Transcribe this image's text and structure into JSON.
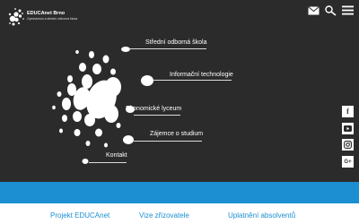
{
  "logo": {
    "title": "EDUCAnet Brno",
    "subtitle": "Gymnázium a střední odborná škola"
  },
  "header": {
    "icons": [
      "mail-icon",
      "search-icon",
      "menu-icon"
    ]
  },
  "menu": [
    {
      "label": "Střední odborná škola"
    },
    {
      "label": "Informační technologie"
    },
    {
      "label": "Ekonomické lyceum"
    },
    {
      "label": "Zájemce o studium"
    },
    {
      "label": "Kontakt"
    }
  ],
  "social": {
    "facebook": "f",
    "youtube": "youtube-icon",
    "instagram": "instagram-icon",
    "googleplus": "G+"
  },
  "footer": {
    "links": [
      "Projekt EDUCAnet",
      "Vize zřizovatele",
      "Uplatnění absolventů"
    ]
  },
  "colors": {
    "background": "#2b2b2b",
    "accent": "#1b8fd1",
    "text": "#ffffff"
  }
}
